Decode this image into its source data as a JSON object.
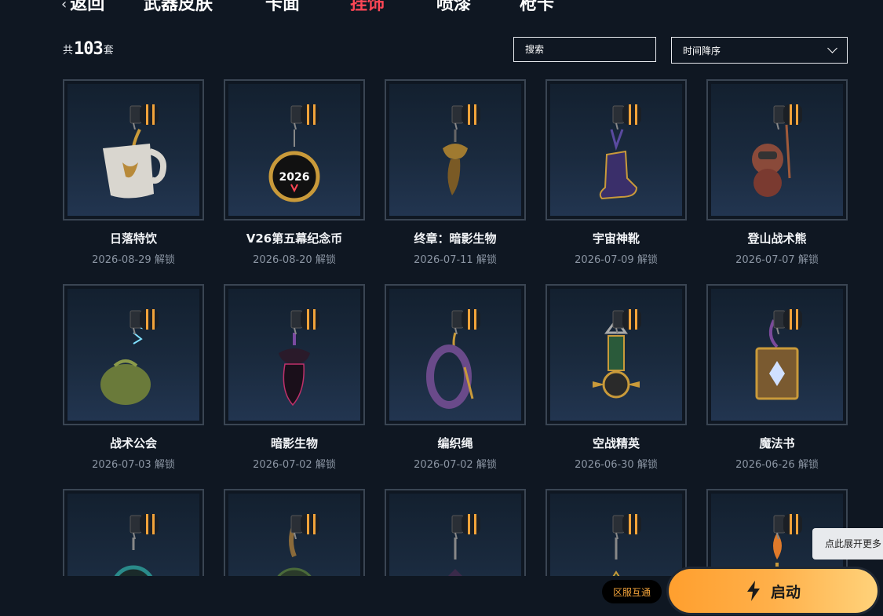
{
  "nav": {
    "back_label": "返回",
    "tabs": [
      {
        "label": "武器皮肤",
        "active": false
      },
      {
        "label": "卡面",
        "active": false
      },
      {
        "label": "挂饰",
        "active": true
      },
      {
        "label": "喷漆",
        "active": false
      },
      {
        "label": "枪卡",
        "active": false
      }
    ]
  },
  "header": {
    "count_prefix": "共",
    "count": "103",
    "count_suffix": "套",
    "search_placeholder": "搜索",
    "sort_value": "时间降序"
  },
  "items": [
    {
      "name": "日落特饮",
      "date": "2026-08-29 解锁",
      "icon": "mug-charm"
    },
    {
      "name": "V26第五幕纪念币",
      "date": "2026-08-20 解锁",
      "icon": "coin-charm"
    },
    {
      "name": "终章：暗影生物",
      "date": "2026-07-11 解锁",
      "icon": "shadow-creature-gold-charm"
    },
    {
      "name": "宇宙神靴",
      "date": "2026-07-09 解锁",
      "icon": "boot-charm"
    },
    {
      "name": "登山战术熊",
      "date": "2026-07-07 解锁",
      "icon": "bear-charm"
    },
    {
      "name": "战术公会",
      "date": "2026-07-03 解锁",
      "icon": "sleepy-creature-charm"
    },
    {
      "name": "暗影生物",
      "date": "2026-07-02 解锁",
      "icon": "shadow-creature-charm"
    },
    {
      "name": "编织绳",
      "date": "2026-07-02 解锁",
      "icon": "braided-rope-charm"
    },
    {
      "name": "空战精英",
      "date": "2026-06-30 解锁",
      "icon": "wings-medal-charm"
    },
    {
      "name": "魔法书",
      "date": "2026-06-26 解锁",
      "icon": "magic-book-charm"
    },
    {
      "name": "",
      "date": "",
      "icon": "teal-pendant-charm"
    },
    {
      "name": "",
      "date": "",
      "icon": "green-orb-charm"
    },
    {
      "name": "",
      "date": "",
      "icon": "purple-blade-charm"
    },
    {
      "name": "",
      "date": "",
      "icon": "green-triangle-charm"
    },
    {
      "name": "",
      "date": "",
      "icon": "flame-candles-charm"
    }
  ],
  "tooltip": "点此展开更多",
  "region_button": "区服互通",
  "launch_button": "启动",
  "colors": {
    "background": "#0f1722",
    "active_tab": "#ff4655",
    "card_border": "#3a4553",
    "launch_gradient_start": "#ff9f2e",
    "launch_gradient_end": "#ffd27a",
    "region_text": "#f3a33a"
  }
}
